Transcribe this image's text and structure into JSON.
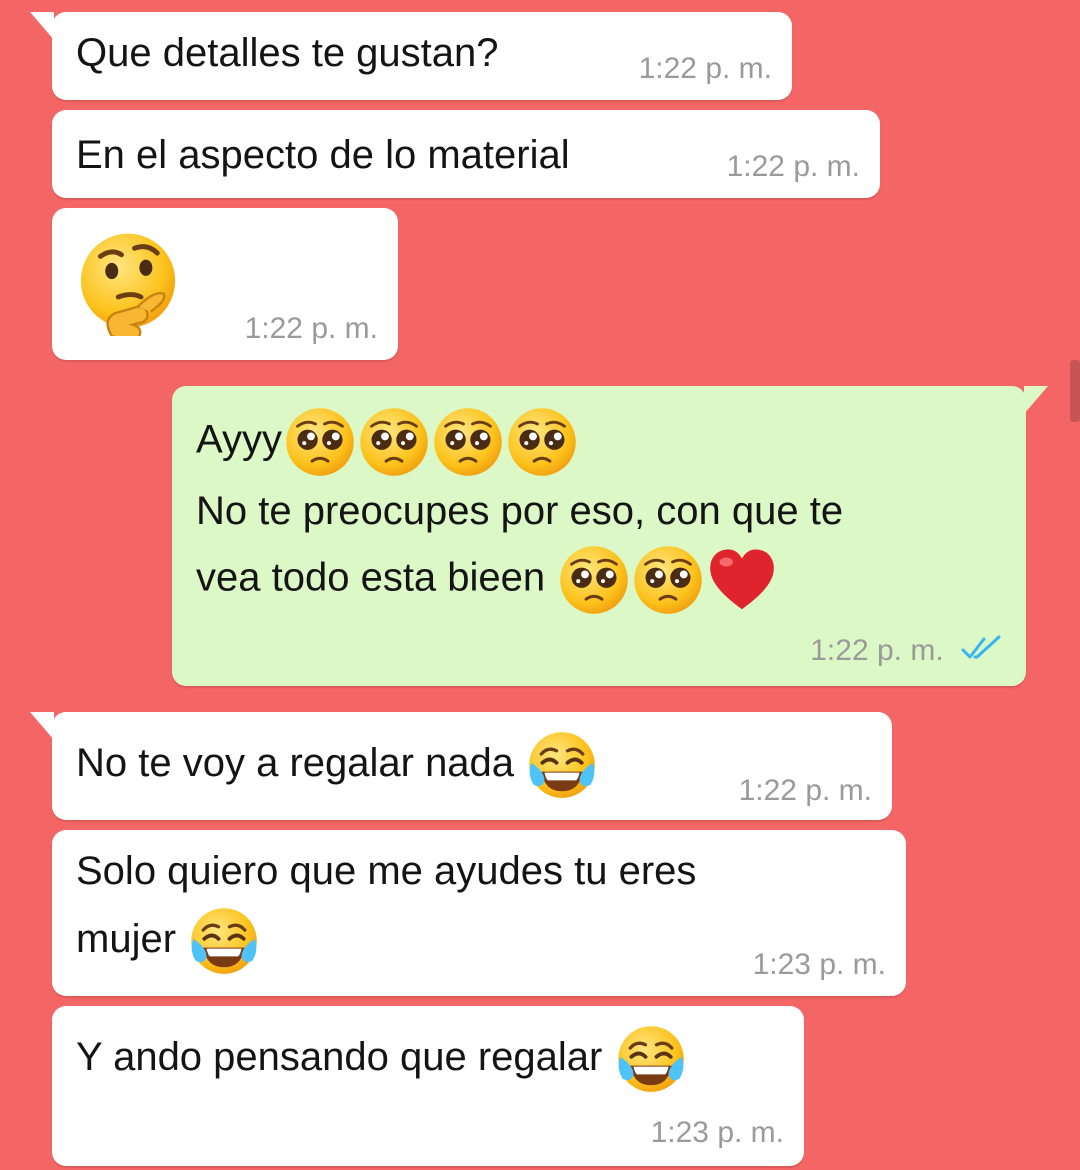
{
  "chat": {
    "messages": [
      {
        "direction": "in",
        "text": "Que detalles te gustan?",
        "time": "1:22 p. m."
      },
      {
        "direction": "in",
        "text": "En el aspecto de lo material",
        "time": "1:22 p. m."
      },
      {
        "direction": "in",
        "emoji": [
          "thinking-face"
        ],
        "time": "1:22 p. m."
      },
      {
        "direction": "out",
        "line1": "Ayyy",
        "line2": "No te preocupes por eso, con que te",
        "line3": "vea todo esta bieen",
        "emoji_line1": [
          "pleading-face",
          "pleading-face",
          "pleading-face",
          "pleading-face"
        ],
        "emoji_line3": [
          "pleading-face",
          "pleading-face",
          "red-heart"
        ],
        "time": "1:22 p. m.",
        "status": "read"
      },
      {
        "direction": "in",
        "text": "No te voy a regalar nada",
        "emoji": [
          "tears-of-joy-face"
        ],
        "time": "1:22 p. m."
      },
      {
        "direction": "in",
        "line1": "Solo quiero que me ayudes tu eres",
        "line2": "mujer",
        "emoji": [
          "tears-of-joy-face"
        ],
        "time": "1:23 p. m."
      },
      {
        "direction": "in",
        "text": "Y ando pensando que regalar",
        "emoji": [
          "tears-of-joy-face"
        ],
        "time": "1:23 p. m."
      }
    ]
  },
  "colors": {
    "background": "#f46566",
    "incoming_bubble": "#ffffff",
    "outgoing_bubble": "#dcf8c6",
    "timestamp": "#9a9a9a",
    "read_ticks": "#34b7f1"
  }
}
